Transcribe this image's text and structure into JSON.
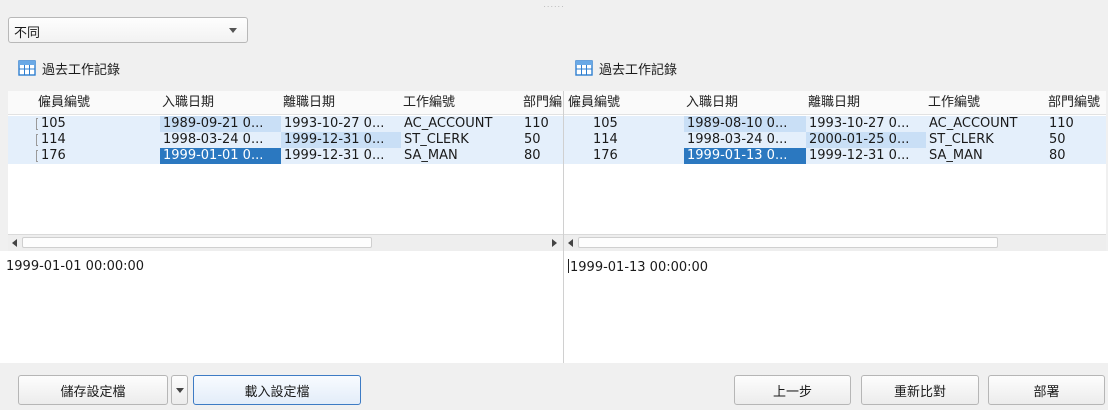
{
  "filter": {
    "selected": "不同"
  },
  "left": {
    "title": "過去工作記錄",
    "columns": [
      "僱員編號",
      "入職日期",
      "離職日期",
      "工作編號",
      "部門編"
    ],
    "rows": [
      [
        "105",
        "1989-09-21 0...",
        "1993-10-27 0...",
        "AC_ACCOUNT",
        "110"
      ],
      [
        "114",
        "1998-03-24 0...",
        "1999-12-31 0...",
        "ST_CLERK",
        "50"
      ],
      [
        "176",
        "1999-01-01 0...",
        "1999-12-31 0...",
        "SA_MAN",
        "80"
      ]
    ],
    "detail": "1999-01-01 00:00:00"
  },
  "right": {
    "title": "過去工作記錄",
    "columns": [
      "僱員編號",
      "入職日期",
      "離職日期",
      "工作編號",
      "部門編號"
    ],
    "rows": [
      [
        "105",
        "1989-08-10 0...",
        "1993-10-27 0...",
        "AC_ACCOUNT",
        "110"
      ],
      [
        "114",
        "1998-03-24 0...",
        "2000-01-25 0...",
        "ST_CLERK",
        "50"
      ],
      [
        "176",
        "1999-01-13 0...",
        "1999-12-31 0...",
        "SA_MAN",
        "80"
      ]
    ],
    "detail": "1999-01-13 00:00:00"
  },
  "buttons": {
    "save": "儲存設定檔",
    "load": "載入設定檔",
    "prev": "上一步",
    "recompare": "重新比對",
    "deploy": "部署"
  },
  "colors": {
    "row": "#e4effb",
    "diff_cell": "#c9dff6",
    "selected_cell": "#2b78c0",
    "primary_border": "#3d7bc4"
  }
}
